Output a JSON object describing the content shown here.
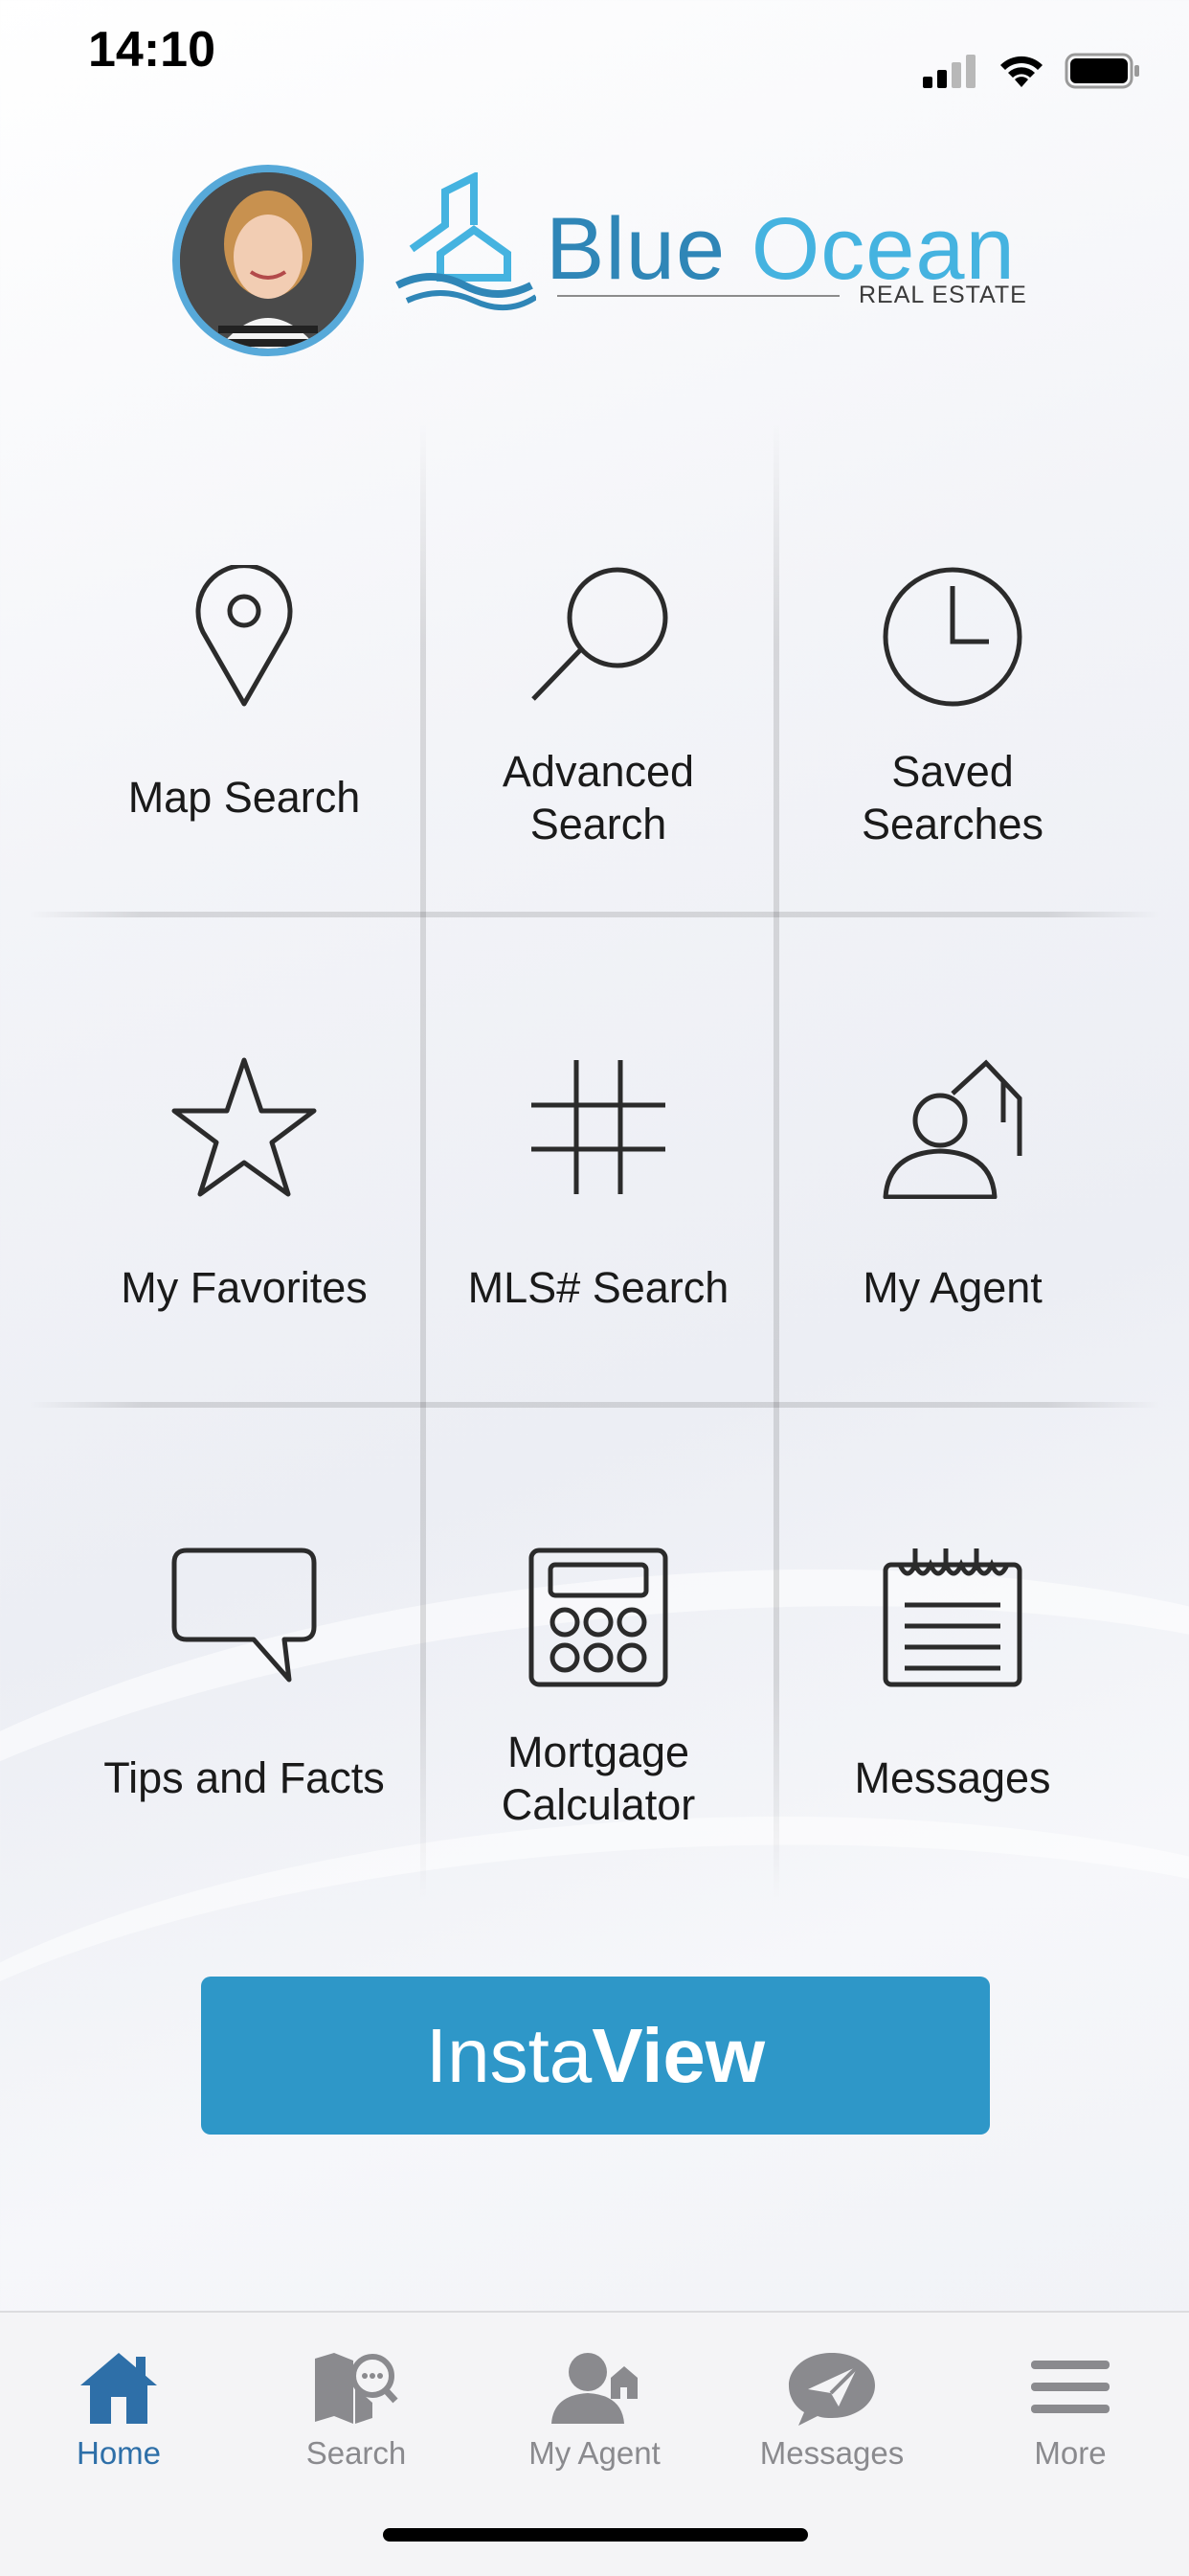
{
  "status_bar": {
    "time": "14:10"
  },
  "header": {
    "logo_word1": "Blue",
    "logo_word2": "Ocean",
    "logo_subtitle": "REAL ESTATE"
  },
  "grid": {
    "items": [
      {
        "label_line1": "Map Search",
        "label_line2": "",
        "icon": "map-pin-icon"
      },
      {
        "label_line1": "Advanced",
        "label_line2": "Search",
        "icon": "magnifier-icon"
      },
      {
        "label_line1": "Saved",
        "label_line2": "Searches",
        "icon": "clock-icon"
      },
      {
        "label_line1": "My Favorites",
        "label_line2": "",
        "icon": "star-icon"
      },
      {
        "label_line1": "MLS# Search",
        "label_line2": "",
        "icon": "hash-icon"
      },
      {
        "label_line1": "My Agent",
        "label_line2": "",
        "icon": "agent-house-icon"
      },
      {
        "label_line1": "Tips and Facts",
        "label_line2": "",
        "icon": "speech-bubble-icon"
      },
      {
        "label_line1": "Mortgage",
        "label_line2": "Calculator",
        "icon": "calculator-icon"
      },
      {
        "label_line1": "Messages",
        "label_line2": "",
        "icon": "notepad-icon"
      }
    ]
  },
  "insta_button": {
    "part1": "Insta",
    "part2": "View",
    "color": "#2e97c8"
  },
  "tab_bar": {
    "active_color": "#2e6fa8",
    "tabs": [
      {
        "label": "Home",
        "icon": "home-icon",
        "active": true
      },
      {
        "label": "Search",
        "icon": "search-map-icon",
        "active": false
      },
      {
        "label": "My Agent",
        "icon": "agent-icon",
        "active": false
      },
      {
        "label": "Messages",
        "icon": "messages-icon",
        "active": false
      },
      {
        "label": "More",
        "icon": "menu-icon",
        "active": false
      }
    ]
  }
}
